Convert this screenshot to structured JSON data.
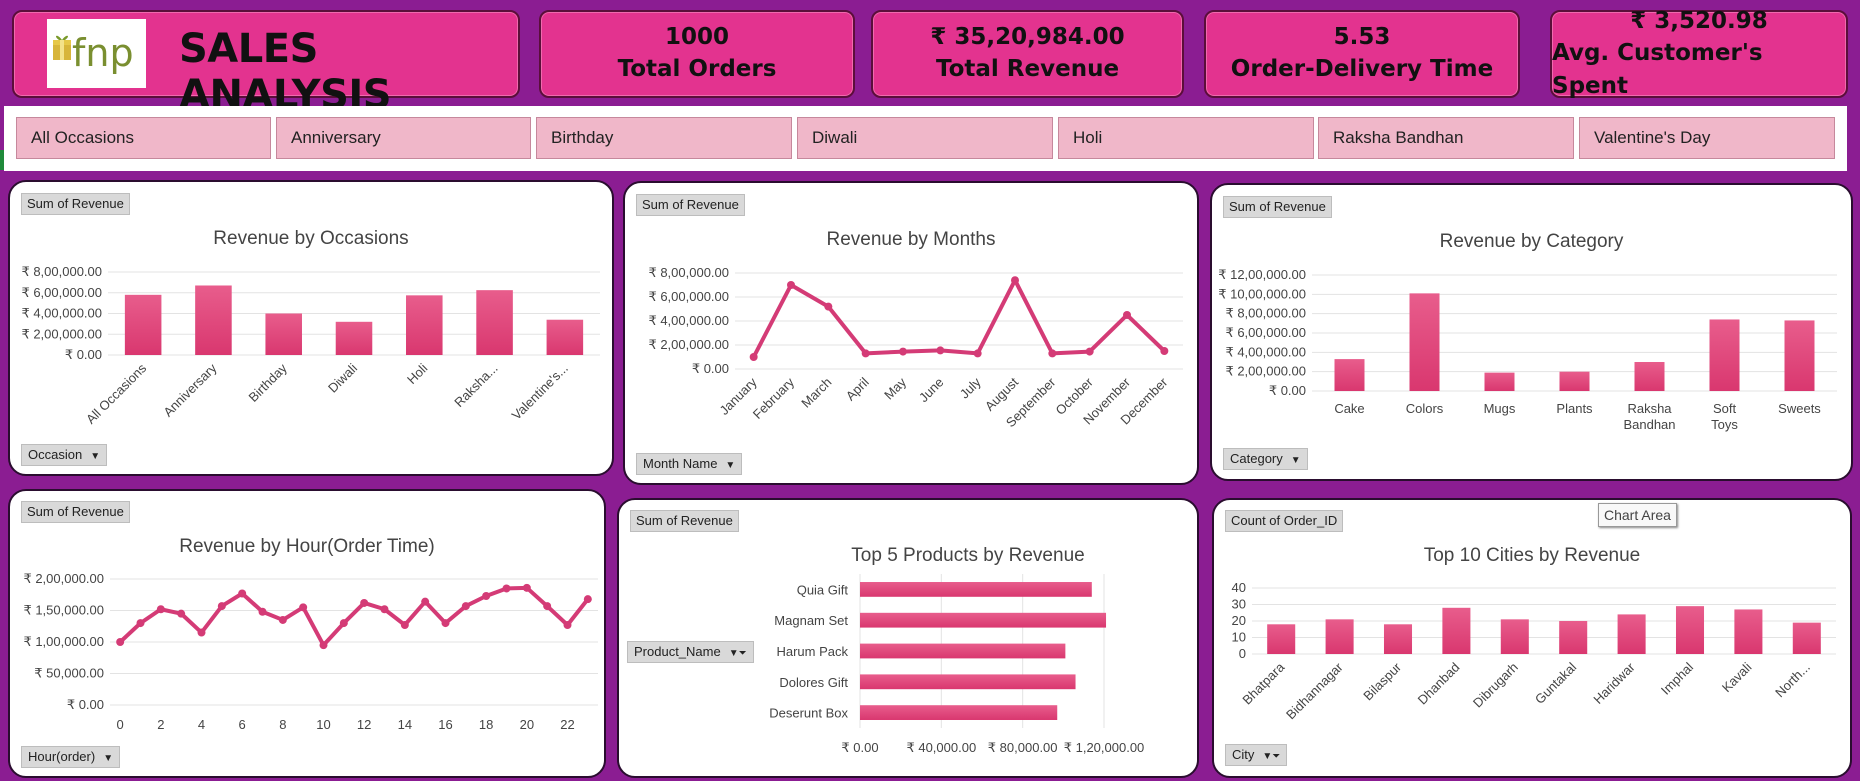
{
  "header": {
    "logo_text": "fnp",
    "title": "SALES ANALYSIS",
    "kpis": [
      {
        "value": "1000",
        "label": "Total Orders"
      },
      {
        "value": "₹ 35,20,984.00",
        "label": "Total Revenue"
      },
      {
        "value": "5.53",
        "label": "Order-Delivery Time"
      },
      {
        "value": "₹ 3,520.98",
        "label": "Avg. Customer's Spent"
      }
    ]
  },
  "slicer": {
    "items": [
      "All Occasions",
      "Anniversary",
      "Birthday",
      "Diwali",
      "Holi",
      "Raksha Bandhan",
      "Valentine's Day"
    ]
  },
  "colors": {
    "bar": "#d9376f",
    "bar_light": "#e85d8c",
    "line": "#d43b76",
    "header": "#e3338f",
    "background": "#8b1d92",
    "slicer_btn": "#f0b7c9"
  },
  "tooltip": "Chart Area",
  "charts": {
    "occasions": {
      "field": "Sum of Revenue",
      "filter": "Occasion"
    },
    "months": {
      "field": "Sum of Revenue",
      "filter": "Month Name"
    },
    "category": {
      "field": "Sum of Revenue",
      "filter": "Category"
    },
    "hour": {
      "field": "Sum of Revenue",
      "filter": "Hour(order)"
    },
    "products": {
      "field": "Sum of Revenue",
      "filter": "Product_Name"
    },
    "cities": {
      "field": "Count of Order_ID",
      "filter": "City"
    }
  },
  "chart_data": [
    {
      "id": "occasions",
      "type": "bar",
      "title": "Revenue by Occasions",
      "categories": [
        "All Occasions",
        "Anniversary",
        "Birthday",
        "Diwali",
        "Holi",
        "Raksha...",
        "Valentine's..."
      ],
      "values": [
        580000,
        670000,
        400000,
        320000,
        575000,
        625000,
        340000
      ],
      "yticks": [
        "₹ 0.00",
        "₹ 2,00,000.00",
        "₹ 4,00,000.00",
        "₹ 6,00,000.00",
        "₹ 8,00,000.00"
      ],
      "ylim": [
        0,
        800000
      ],
      "grid": true
    },
    {
      "id": "months",
      "type": "line",
      "title": "Revenue by Months",
      "categories": [
        "January",
        "February",
        "March",
        "April",
        "May",
        "June",
        "July",
        "August",
        "September",
        "October",
        "November",
        "December"
      ],
      "values": [
        100000,
        700000,
        520000,
        130000,
        145000,
        155000,
        130000,
        740000,
        130000,
        145000,
        450000,
        150000
      ],
      "yticks": [
        "₹ 0.00",
        "₹ 2,00,000.00",
        "₹ 4,00,000.00",
        "₹ 6,00,000.00",
        "₹ 8,00,000.00"
      ],
      "ylim": [
        0,
        800000
      ],
      "grid": true
    },
    {
      "id": "category",
      "type": "bar",
      "title": "Revenue by Category",
      "categories": [
        "Cake",
        "Colors",
        "Mugs",
        "Plants",
        "Raksha Bandhan",
        "Soft Toys",
        "Sweets"
      ],
      "values": [
        330000,
        1010000,
        190000,
        200000,
        300000,
        740000,
        730000
      ],
      "yticks": [
        "₹ 0.00",
        "₹ 2,00,000.00",
        "₹ 4,00,000.00",
        "₹ 6,00,000.00",
        "₹ 8,00,000.00",
        "₹ 10,00,000.00",
        "₹ 12,00,000.00"
      ],
      "ylim": [
        0,
        1200000
      ],
      "grid": true
    },
    {
      "id": "hour",
      "type": "line",
      "title": "Revenue by Hour(Order Time)",
      "categories": [
        "0",
        "1",
        "2",
        "3",
        "4",
        "5",
        "6",
        "7",
        "8",
        "9",
        "10",
        "11",
        "12",
        "13",
        "14",
        "15",
        "16",
        "17",
        "18",
        "19",
        "20",
        "21",
        "22",
        "23"
      ],
      "xticks": [
        "0",
        "2",
        "4",
        "6",
        "8",
        "10",
        "12",
        "14",
        "16",
        "18",
        "20",
        "22"
      ],
      "values": [
        100000,
        130000,
        152000,
        145000,
        115000,
        157000,
        177000,
        148000,
        135000,
        155000,
        95000,
        130000,
        162000,
        152000,
        127000,
        164000,
        130000,
        157000,
        173000,
        185000,
        186000,
        157000,
        127000,
        168000
      ],
      "yticks": [
        "₹ 0.00",
        "₹ 50,000.00",
        "₹ 1,00,000.00",
        "₹ 1,50,000.00",
        "₹ 2,00,000.00"
      ],
      "ylim": [
        0,
        200000
      ],
      "grid": true
    },
    {
      "id": "products",
      "type": "bar",
      "orientation": "horizontal",
      "title": "Top 5 Products by Revenue",
      "categories": [
        "Quia Gift",
        "Magnam Set",
        "Harum Pack",
        "Dolores Gift",
        "Deserunt Box"
      ],
      "values": [
        114000,
        121000,
        101000,
        106000,
        97000
      ],
      "xticks": [
        "₹ 0.00",
        "₹ 40,000.00",
        "₹ 80,000.00",
        "₹ 1,20,000.00"
      ],
      "xlim": [
        0,
        120000
      ],
      "grid": true
    },
    {
      "id": "cities",
      "type": "bar",
      "title": "Top 10 Cities by Revenue",
      "categories": [
        "Bhatpara",
        "Bidhannagar",
        "Bilaspur",
        "Dhanbad",
        "Dibrugarh",
        "Guntakal",
        "Haridwar",
        "Imphal",
        "Kavali",
        "North..."
      ],
      "values": [
        18,
        21,
        18,
        28,
        21,
        20,
        24,
        29,
        27,
        19
      ],
      "yticks": [
        "0",
        "10",
        "20",
        "30",
        "40"
      ],
      "ylim": [
        0,
        40
      ],
      "grid": true
    }
  ]
}
